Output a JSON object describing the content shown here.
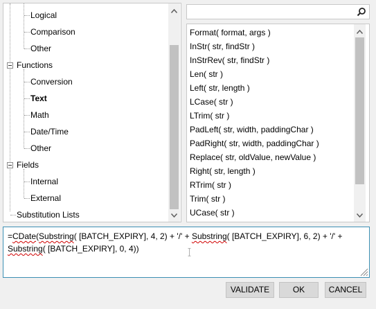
{
  "tree": {
    "items": [
      {
        "label": "Logical"
      },
      {
        "label": "Comparison"
      },
      {
        "label": "Other"
      },
      {
        "label": "Functions"
      },
      {
        "label": "Conversion"
      },
      {
        "label": "Text"
      },
      {
        "label": "Math"
      },
      {
        "label": "Date/Time"
      },
      {
        "label": "Other"
      },
      {
        "label": "Fields"
      },
      {
        "label": "Internal"
      },
      {
        "label": "External"
      },
      {
        "label": "Substitution Lists"
      }
    ]
  },
  "search": {
    "value": "",
    "placeholder": ""
  },
  "functions": {
    "items": [
      {
        "label": "Format( format, args )"
      },
      {
        "label": "InStr( str, findStr )"
      },
      {
        "label": "InStrRev( str, findStr )"
      },
      {
        "label": "Len( str )"
      },
      {
        "label": "Left( str, length )"
      },
      {
        "label": "LCase( str )"
      },
      {
        "label": "LTrim( str )"
      },
      {
        "label": "PadLeft( str, width, paddingChar )"
      },
      {
        "label": "PadRight( str, width, paddingChar )"
      },
      {
        "label": "Replace( str, oldValue, newValue )"
      },
      {
        "label": "Right( str, length )"
      },
      {
        "label": "RTrim( str )"
      },
      {
        "label": "Trim( str )"
      },
      {
        "label": "UCase( str )"
      }
    ]
  },
  "expression": {
    "prefix": "=",
    "cdate": "CDate",
    "paren_open": "(",
    "substring": "Substring",
    "part1": "( [BATCH_EXPIRY], 4, 2) + '/' + ",
    "part2": "( [BATCH_EXPIRY], 6, 2) + '/' + ",
    "part3": "( [BATCH_EXPIRY], 0, 4))"
  },
  "buttons": {
    "validate": "VALIDATE",
    "ok": "OK",
    "cancel": "CANCEL"
  },
  "colors": {
    "accent_border": "#3c8fb3",
    "spell_error": "#d00000"
  }
}
